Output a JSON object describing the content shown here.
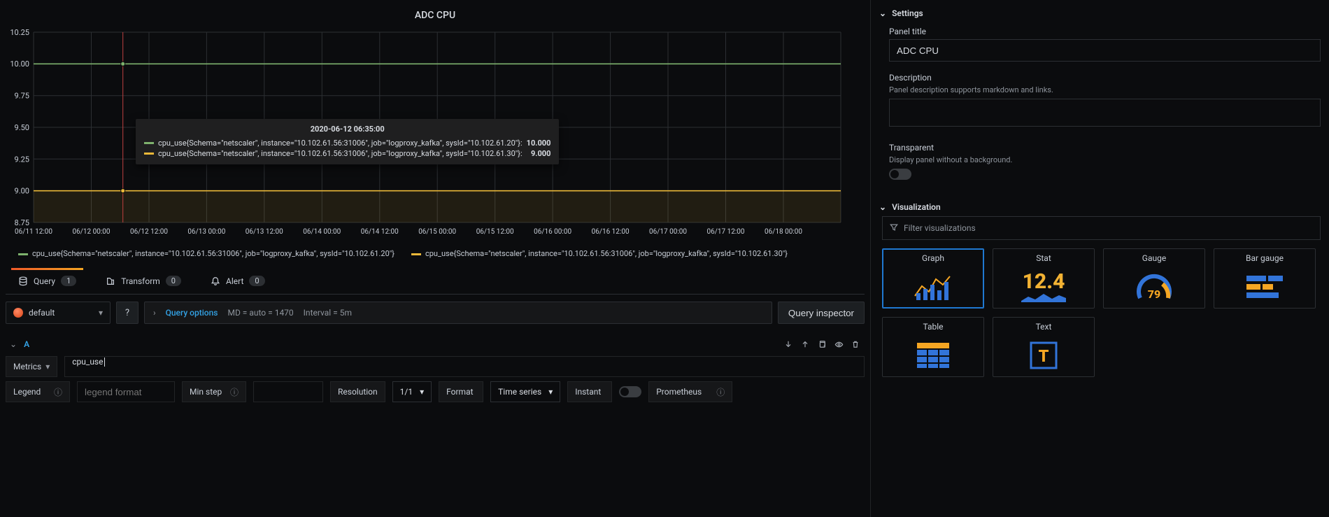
{
  "panel": {
    "title": "ADC CPU"
  },
  "chart_data": {
    "type": "line",
    "title": "ADC CPU",
    "xlabel": "",
    "ylabel": "",
    "ylim": [
      8.75,
      10.25
    ],
    "y_ticks": [
      "10.25",
      "10.00",
      "9.75",
      "9.50",
      "9.25",
      "9.00",
      "8.75"
    ],
    "x_ticks": [
      "06/11 12:00",
      "06/12 00:00",
      "06/12 12:00",
      "06/13 00:00",
      "06/13 12:00",
      "06/14 00:00",
      "06/14 12:00",
      "06/15 00:00",
      "06/15 12:00",
      "06/16 00:00",
      "06/16 12:00",
      "06/17 00:00",
      "06/17 12:00",
      "06/18 00:00"
    ],
    "series": [
      {
        "name": "cpu_use{Schema=\"netscaler\", instance=\"10.102.61.56:31006\", job=\"logproxy_kafka\", sysId=\"10.102.61.20\"}",
        "color": "#7eb26d",
        "constant_value": 10.0
      },
      {
        "name": "cpu_use{Schema=\"netscaler\", instance=\"10.102.61.56:31006\", job=\"logproxy_kafka\", sysId=\"10.102.61.30\"}",
        "color": "#eab839",
        "constant_value": 9.0
      }
    ],
    "cursor_x_label": "06/12 06:35:00"
  },
  "tooltip": {
    "time": "2020-06-12 06:35:00",
    "rows": [
      {
        "label": "cpu_use{Schema=\"netscaler\", instance=\"10.102.61.56:31006\", job=\"logproxy_kafka\", sysId=\"10.102.61.20\"}:",
        "value": "10.000",
        "color": "#7eb26d"
      },
      {
        "label": "cpu_use{Schema=\"netscaler\", instance=\"10.102.61.56:31006\", job=\"logproxy_kafka\", sysId=\"10.102.61.30\"}:",
        "value": "9.000",
        "color": "#eab839"
      }
    ]
  },
  "legend": [
    {
      "label": "cpu_use{Schema=\"netscaler\", instance=\"10.102.61.56:31006\", job=\"logproxy_kafka\", sysId=\"10.102.61.20\"}",
      "color": "#7eb26d"
    },
    {
      "label": "cpu_use{Schema=\"netscaler\", instance=\"10.102.61.56:31006\", job=\"logproxy_kafka\", sysId=\"10.102.61.30\"}",
      "color": "#eab839"
    }
  ],
  "tabs": {
    "query": {
      "label": "Query",
      "count": "1"
    },
    "transform": {
      "label": "Transform",
      "count": "0"
    },
    "alert": {
      "label": "Alert",
      "count": "0"
    }
  },
  "datasource": {
    "selected": "default"
  },
  "query_options": {
    "link": "Query options",
    "md": "MD = auto = 1470",
    "interval": "Interval = 5m",
    "inspector": "Query inspector"
  },
  "queryA": {
    "letter": "A",
    "metrics_label": "Metrics",
    "metrics_value": "cpu_use",
    "legend_label": "Legend",
    "legend_placeholder": "legend format",
    "minstep_label": "Min step",
    "resolution_label": "Resolution",
    "resolution_value": "1/1",
    "format_label": "Format",
    "format_value": "Time series",
    "instant_label": "Instant",
    "prometheus_label": "Prometheus"
  },
  "side": {
    "settings": {
      "title": "Settings",
      "panel_title_label": "Panel title",
      "panel_title_value": "ADC CPU",
      "description_label": "Description",
      "description_help": "Panel description supports markdown and links.",
      "transparent_label": "Transparent",
      "transparent_help": "Display panel without a background."
    },
    "visualization": {
      "title": "Visualization",
      "filter_placeholder": "Filter visualizations",
      "cards": {
        "graph": "Graph",
        "stat": "Stat",
        "stat_value": "12.4",
        "gauge": "Gauge",
        "gauge_value": "79",
        "bargauge": "Bar gauge",
        "table": "Table",
        "text": "Text"
      }
    }
  }
}
